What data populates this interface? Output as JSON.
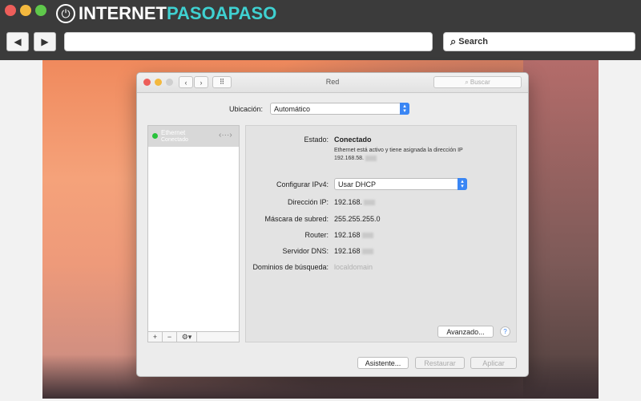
{
  "browser": {
    "logo_part1": "INTERNET",
    "logo_part2": "PASOAPASO",
    "search_label": "Search",
    "back_glyph": "◀",
    "forward_glyph": "▶",
    "traffic_colors": [
      "#ed5e5a",
      "#f3b83e",
      "#5fc84b"
    ]
  },
  "window": {
    "title": "Red",
    "search_placeholder": "Buscar",
    "location": {
      "label": "Ubicación:",
      "value": "Automático"
    },
    "sidebar": {
      "items": [
        {
          "name": "Ethernet",
          "status": "Conectado"
        }
      ],
      "add_glyph": "+",
      "remove_glyph": "−",
      "gear_glyph": "⚙▾"
    },
    "details": {
      "estado_label": "Estado:",
      "estado_value": "Conectado",
      "estado_desc_line1": "Ethernet está activo y tiene asignada la dirección IP",
      "estado_desc_line2": "192.168.58.",
      "ipv4_label": "Configurar IPv4:",
      "ipv4_value": "Usar DHCP",
      "ip_label": "Dirección IP:",
      "ip_value": "192.168.",
      "mask_label": "Máscara de subred:",
      "mask_value": "255.255.255.0",
      "router_label": "Router:",
      "router_value": "192.168",
      "dns_label": "Servidor DNS:",
      "dns_value": "192.168",
      "domains_label": "Dominios de búsqueda:",
      "domains_value": "localdomain"
    },
    "buttons": {
      "advanced": "Avanzado...",
      "help": "?",
      "assistant": "Asistente...",
      "restore": "Restaurar",
      "apply": "Aplicar"
    }
  }
}
